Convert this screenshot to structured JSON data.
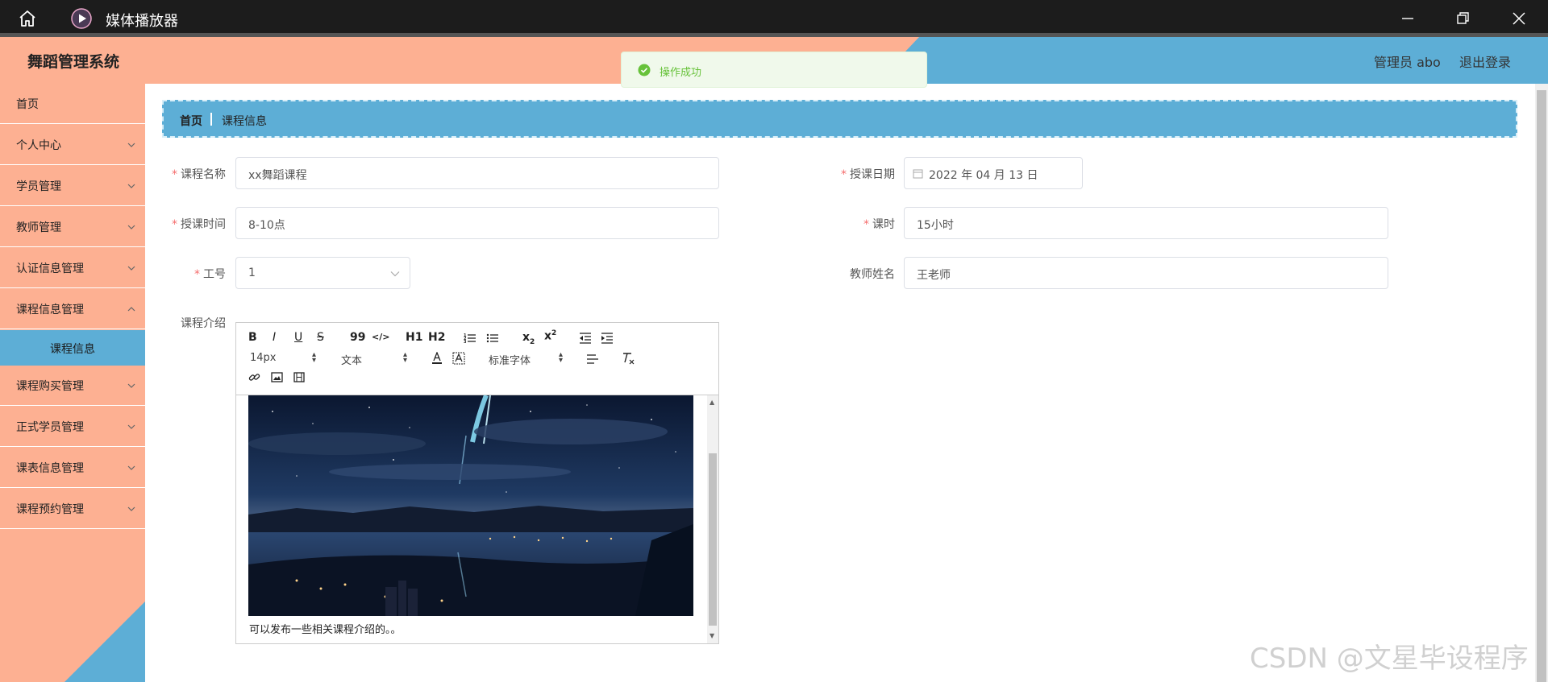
{
  "window": {
    "app_title": "媒体播放器"
  },
  "header": {
    "system_title": "舞蹈管理系统",
    "user_label": "管理员 abo",
    "logout_label": "退出登录",
    "colors": {
      "left": "#fdb092",
      "right": "#5daed6"
    }
  },
  "toast": {
    "message": "操作成功"
  },
  "sidebar": {
    "items": [
      {
        "label": "首页"
      },
      {
        "label": "个人中心"
      },
      {
        "label": "学员管理"
      },
      {
        "label": "教师管理"
      },
      {
        "label": "认证信息管理"
      },
      {
        "label": "课程信息管理"
      },
      {
        "label": "课程信息"
      },
      {
        "label": "课程购买管理"
      },
      {
        "label": "正式学员管理"
      },
      {
        "label": "课表信息管理"
      },
      {
        "label": "课程预约管理"
      }
    ]
  },
  "breadcrumb": {
    "home": "首页",
    "current": "课程信息"
  },
  "form": {
    "course_name": {
      "label": "课程名称",
      "value": "xx舞蹈课程"
    },
    "teach_date": {
      "label": "授课日期",
      "value": "2022 年 04 月 13 日"
    },
    "teach_time": {
      "label": "授课时间",
      "value": "8-10点"
    },
    "hours": {
      "label": "课时",
      "value": "15小时"
    },
    "job_no": {
      "label": "工号",
      "value": "1"
    },
    "teacher_name": {
      "label": "教师姓名",
      "value": "王老师"
    },
    "intro": {
      "label": "课程介绍",
      "caption": "可以发布一些相关课程介绍的。。"
    }
  },
  "editor": {
    "font_size": "14px",
    "block_type": "文本",
    "font_family": "标准字体",
    "buttons": {
      "bold": "B",
      "italic": "I",
      "underline": "U",
      "strike": "S",
      "quote": "99",
      "code": "</>",
      "h1": "H1",
      "h2": "H2",
      "sub": "x2",
      "sup": "x2"
    }
  },
  "watermark": "CSDN @文星毕设程序"
}
